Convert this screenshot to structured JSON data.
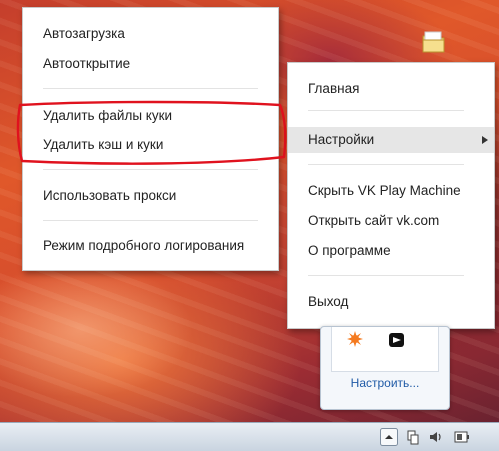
{
  "submenu": {
    "items": [
      {
        "label": "Автозагрузка"
      },
      {
        "label": "Автооткрытие"
      },
      {
        "label": "Удалить файлы куки"
      },
      {
        "label": "Удалить кэш и куки"
      },
      {
        "label": "Использовать прокси"
      },
      {
        "label": "Режим подробного логирования"
      }
    ]
  },
  "mainmenu": {
    "items": [
      {
        "label": "Главная"
      },
      {
        "label": "Настройки",
        "highlighted": true,
        "has_submenu": true
      },
      {
        "label": "Скрыть VK Play Machine"
      },
      {
        "label": "Открыть сайт vk.com"
      },
      {
        "label": "О программе"
      },
      {
        "label": "Выход"
      }
    ]
  },
  "tray_popup": {
    "configure_label": "Настроить..."
  },
  "colors": {
    "annotation": "#e0121e",
    "highlight": "#e6e6e6",
    "link": "#1f5aa6"
  },
  "icons": [
    "folder-icon",
    "avast-icon",
    "vk-play-icon",
    "tray-expand-icon",
    "network-icon",
    "volume-icon",
    "power-icon"
  ]
}
